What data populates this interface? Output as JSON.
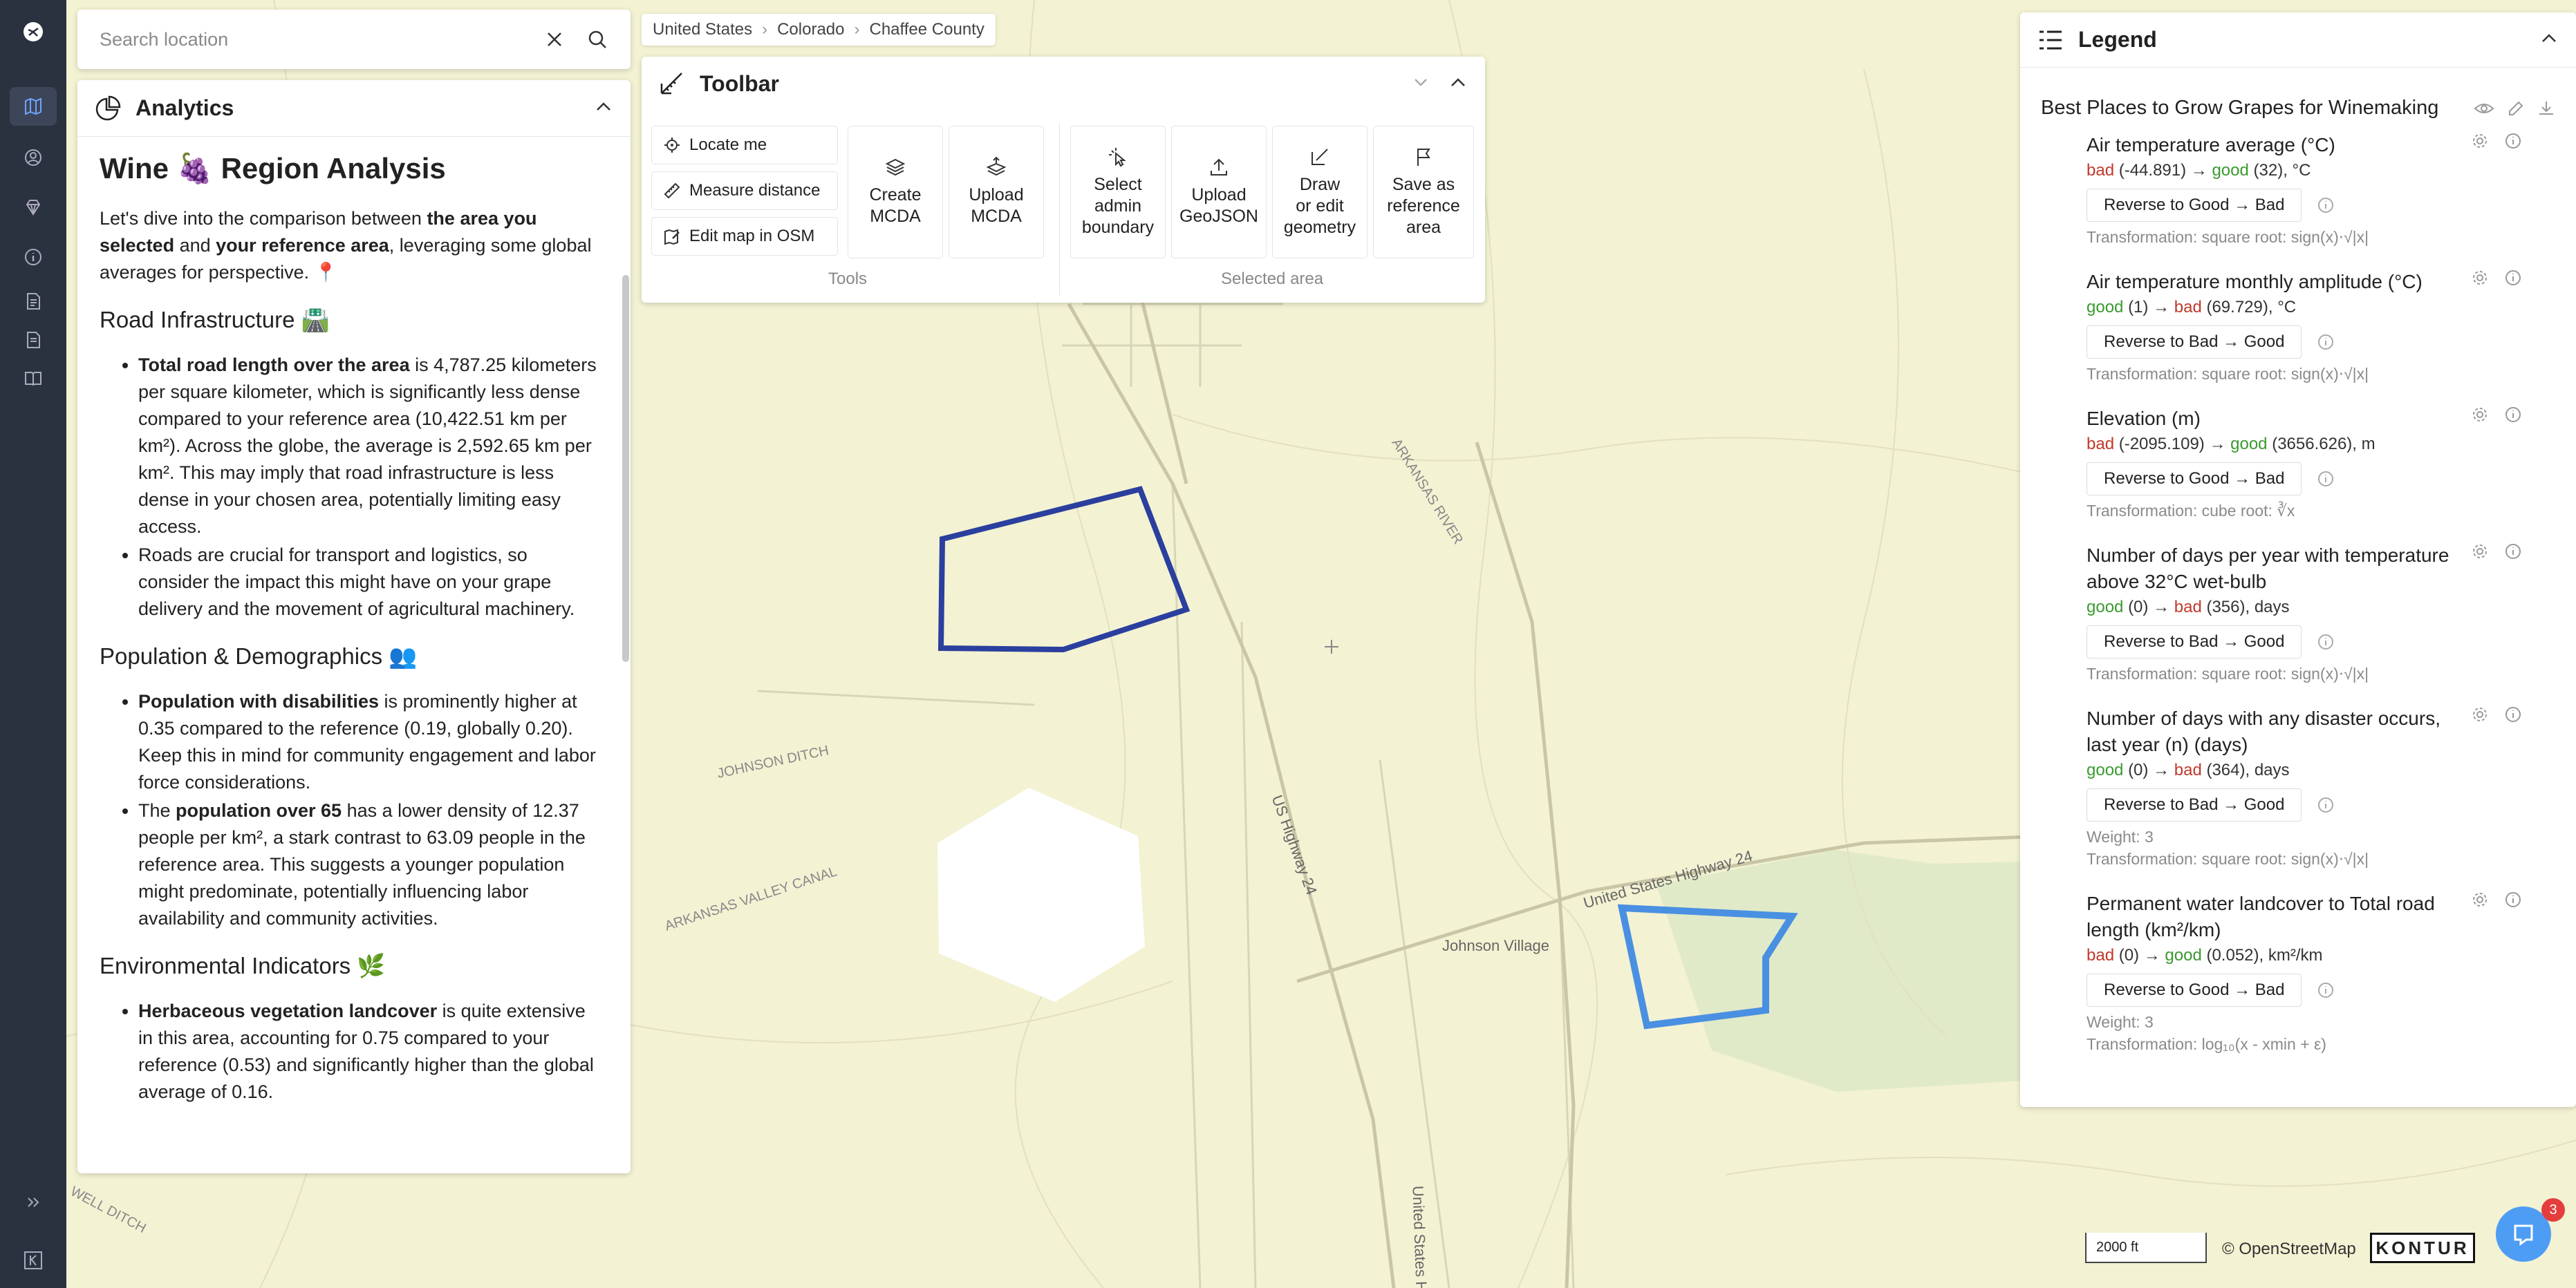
{
  "search": {
    "placeholder": "Search location"
  },
  "breadcrumb": [
    "United States",
    "Colorado",
    "Chaffee County"
  ],
  "analytics": {
    "title": "Analytics",
    "heading": "Wine 🍇 Region Analysis",
    "intro": {
      "p1": "Let's dive into the comparison between ",
      "b1": "the area you selected",
      "p2": " and ",
      "b2": "your reference area",
      "p3": ", leveraging some global averages for perspective. 📍"
    },
    "sections": {
      "road": {
        "title": "Road Infrastructure 🛣️",
        "b1_bold": "Total road length over the area",
        "b1_text": " is 4,787.25 kilometers per square kilometer, which is significantly less dense compared to your reference area (10,422.51 km per km²). Across the globe, the average is 2,592.65 km per km². This may imply that road infrastructure is less dense in your chosen area, potentially limiting easy access.",
        "b2_text": "Roads are crucial for transport and logistics, so consider the impact this might have on your grape delivery and the movement of agricultural machinery."
      },
      "population": {
        "title": "Population & Demographics 👥",
        "b1_bold": "Population with disabilities",
        "b1_text": " is prominently higher at 0.35 compared to the reference (0.19, globally 0.20). Keep this in mind for community engagement and labor force considerations.",
        "b2_pre": "The ",
        "b2_bold": "population over 65",
        "b2_text": " has a lower density of 12.37 people per km², a stark contrast to 63.09 people in the reference area. This suggests a younger population might predominate, potentially influencing labor availability and community activities."
      },
      "environment": {
        "title": "Environmental Indicators 🌿",
        "b1_bold": "Herbaceous vegetation landcover",
        "b1_text": " is quite extensive in this area, accounting for 0.75 compared to your reference (0.53) and significantly higher than the global average of 0.16."
      }
    }
  },
  "toolbar": {
    "title": "Toolbar",
    "locate": "Locate me",
    "measure": "Measure distance",
    "edit_osm": "Edit map in OSM",
    "create_mcda": "Create\nMCDA",
    "upload_mcda": "Upload\nMCDA",
    "select_admin": "Select\nadmin\nboundary",
    "upload_geojson": "Upload\nGeoJSON",
    "draw_edit": "Draw\nor edit\ngeometry",
    "save_ref": "Save as\nreference\narea",
    "group_tools": "Tools",
    "group_selected": "Selected area"
  },
  "legend": {
    "title": "Legend",
    "layer_title": "Best Places to Grow Grapes for Winemaking",
    "items": [
      {
        "name": "Air temperature average (°C)",
        "from_label": "bad",
        "from_val": "(-44.891)",
        "to_label": "good",
        "to_val": "(32), °C",
        "from_class": "bad",
        "to_class": "good",
        "button": "Reverse to Good → Bad",
        "weight": "",
        "transform": "Transformation: square root: sign(x)⋅√|x|"
      },
      {
        "name": "Air temperature monthly amplitude (°C)",
        "from_label": "good",
        "from_val": "(1)",
        "to_label": "bad",
        "to_val": "(69.729), °C",
        "from_class": "good",
        "to_class": "bad",
        "button": "Reverse to Bad → Good",
        "weight": "",
        "transform": "Transformation: square root: sign(x)⋅√|x|"
      },
      {
        "name": "Elevation (m)",
        "from_label": "bad",
        "from_val": "(-2095.109)",
        "to_label": "good",
        "to_val": "(3656.626), m",
        "from_class": "bad",
        "to_class": "good",
        "button": "Reverse to Good → Bad",
        "weight": "",
        "transform": "Transformation: cube root: ∛x"
      },
      {
        "name": "Number of days per year with temperature above 32°C wet-bulb",
        "from_label": "good",
        "from_val": "(0)",
        "to_label": "bad",
        "to_val": "(356), days",
        "from_class": "good",
        "to_class": "bad",
        "button": "Reverse to Bad → Good",
        "weight": "",
        "transform": "Transformation: square root: sign(x)⋅√|x|"
      },
      {
        "name": "Number of days with any disaster occurs, last year (n) (days)",
        "from_label": "good",
        "from_val": "(0)",
        "to_label": "bad",
        "to_val": "(364), days",
        "from_class": "good",
        "to_class": "bad",
        "button": "Reverse to Bad → Good",
        "weight": "Weight: 3",
        "transform": "Transformation: square root: sign(x)⋅√|x|"
      },
      {
        "name": "Permanent water landcover to Total road length (km²/km)",
        "from_label": "bad",
        "from_val": "(0)",
        "to_label": "good",
        "to_val": "(0.052), km²/km",
        "from_class": "bad",
        "to_class": "good",
        "button": "Reverse to Good → Bad",
        "weight": "Weight: 3",
        "transform": "Transformation: log₁₀(x - xmin + ε)"
      }
    ]
  },
  "map": {
    "labels": {
      "johnson_ditch": "JOHNSON DITCH",
      "arkansas_valley_canal": "ARKANSAS VALLEY CANAL",
      "arkansas_river": "ARKANSAS RIVER",
      "us_highway_24": "US Highway 24",
      "united_states_highway_24": "United States Highway 24",
      "johnson_village": "Johnson Village",
      "well_ditch": "WELL DITCH",
      "united_states_h": "United States H"
    },
    "scale": "2000 ft",
    "copyright": "© OpenStreetMap",
    "logo": "KONTUR",
    "chat_badge": "3",
    "colors": {
      "selected_area": "#2a3f9e",
      "reference_area": "#4a90e2",
      "map_bg": "#f3f2d3"
    }
  }
}
